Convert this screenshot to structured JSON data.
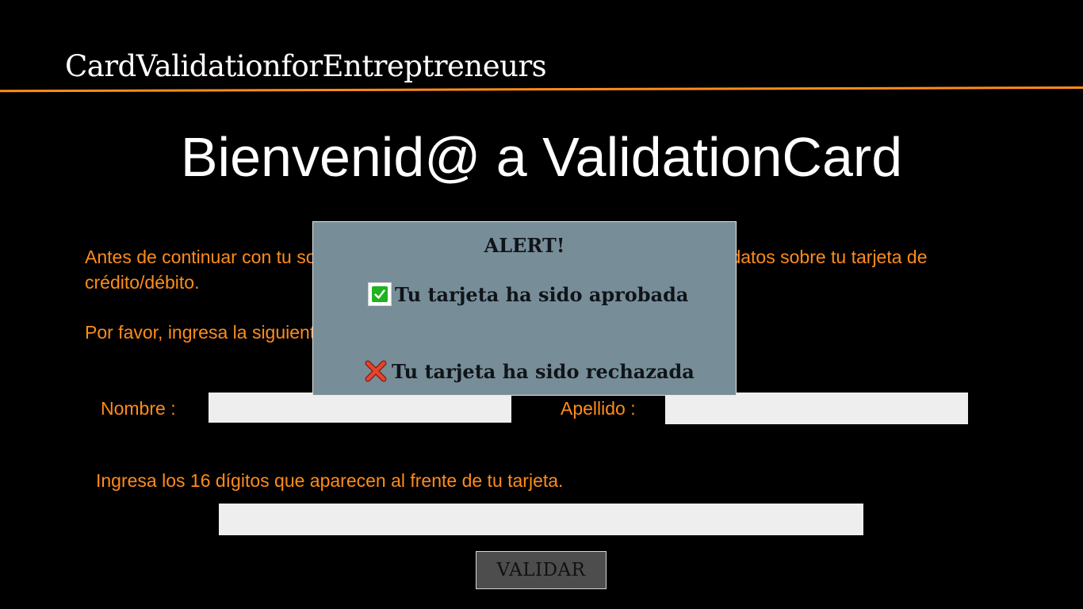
{
  "header": {
    "brand": "CardValidationforEntreptreneurs",
    "accent_color": "#ff8c1a"
  },
  "main": {
    "welcome_title": "Bienvenid@ a ValidationCard",
    "intro_text": "Antes de continuar con tu solicitud, es necesario que nos proporciones algunos datos sobre tu tarjeta de crédito/débito.",
    "instruction_text": "Por favor, ingresa la siguiente información.",
    "form": {
      "first_name_label": "Nombre :",
      "first_name_value": "",
      "last_name_label": "Apellido :",
      "last_name_value": "",
      "card_label": "Ingresa los 16 dígitos que aparecen al frente de tu tarjeta.",
      "card_value": "",
      "submit_label": "VALIDAR"
    }
  },
  "alert": {
    "title": "ALERT!",
    "approved_text": "Tu tarjeta ha sido aprobada",
    "approved_icon": "check-mark-icon",
    "rejected_text": "Tu tarjeta ha sido rechazada",
    "rejected_icon": "cross-mark-icon",
    "background_color": "#778e99"
  }
}
